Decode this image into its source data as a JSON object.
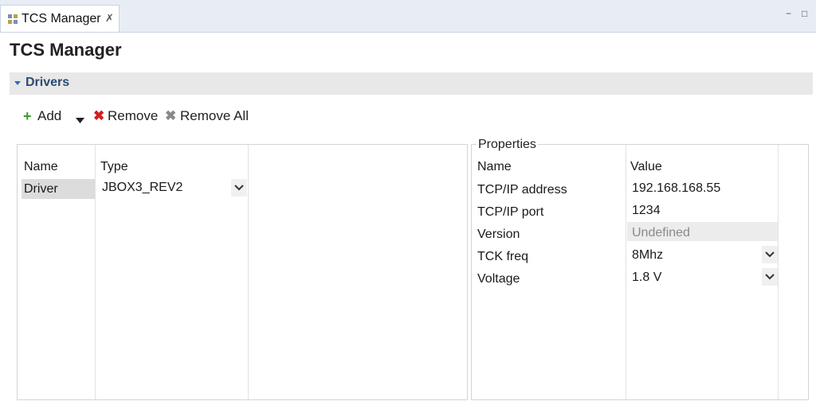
{
  "tab": {
    "label": "TCS Manager",
    "close": "✗"
  },
  "window_controls": {
    "minimize": "−",
    "maximize": "□"
  },
  "page_title": "TCS Manager",
  "section": {
    "label": "Drivers"
  },
  "toolbar": {
    "add": "Add",
    "remove": "Remove",
    "remove_all": "Remove All"
  },
  "drivers": {
    "headers": {
      "name": "Name",
      "type": "Type"
    },
    "rows": [
      {
        "name": "Driver",
        "type": "JBOX3_REV2"
      }
    ]
  },
  "properties": {
    "legend": "Properties",
    "headers": {
      "name": "Name",
      "value": "Value"
    },
    "rows": [
      {
        "name": "TCP/IP address",
        "value": "192.168.168.55"
      },
      {
        "name": "TCP/IP port",
        "value": "1234"
      },
      {
        "name": "Version",
        "value": "Undefined"
      },
      {
        "name": "TCK freq",
        "value": "8Mhz"
      },
      {
        "name": "Voltage",
        "value": "1.8 V"
      }
    ]
  },
  "colors": {
    "accent": "#2a6cc4",
    "add_green": "#3a9a2a",
    "remove_red": "#d02020"
  }
}
